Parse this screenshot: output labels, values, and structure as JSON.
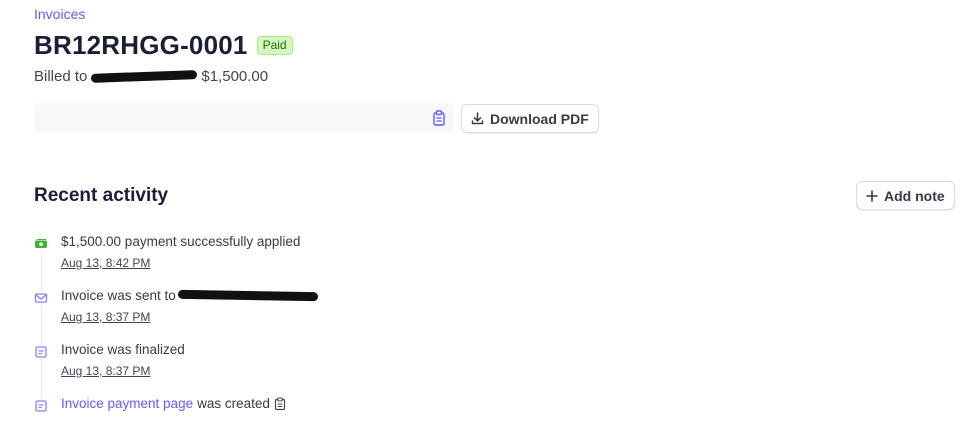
{
  "breadcrumb": {
    "label": "Invoices"
  },
  "invoice": {
    "number": "BR12RHGG-0001",
    "status": "Paid",
    "billed_prefix": "Billed to",
    "amount": "$1,500.00"
  },
  "actions": {
    "download_label": "Download PDF",
    "add_note_label": "Add note"
  },
  "activity": {
    "title": "Recent activity",
    "items": [
      {
        "icon": "money-icon",
        "text": "$1,500.00 payment successfully applied",
        "time": "Aug 13, 8:42 PM"
      },
      {
        "icon": "envelope-icon",
        "text": "Invoice was sent to",
        "time": "Aug 13, 8:37 PM"
      },
      {
        "icon": "document-icon",
        "text": "Invoice was finalized",
        "time": "Aug 13, 8:37 PM"
      },
      {
        "icon": "document-icon",
        "link": "Invoice payment page",
        "text": "was created"
      }
    ]
  },
  "colors": {
    "accent": "#625afa",
    "paid_badge_bg": "#d7f7c2",
    "paid_badge_text": "#217005",
    "payment_icon": "#3fb33a"
  }
}
